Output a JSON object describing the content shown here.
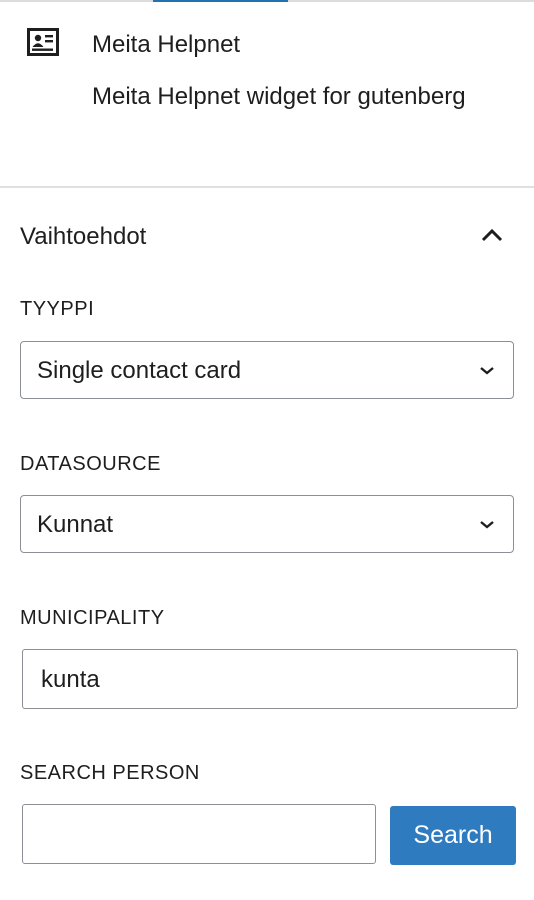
{
  "block": {
    "icon": "contact-card-icon",
    "title": "Meita Helpnet",
    "description": "Meita Helpnet widget for gutenberg"
  },
  "panel": {
    "title": "Vaihtoehdot",
    "toggle_icon": "chevron-up-icon",
    "expanded": true
  },
  "fields": {
    "type": {
      "label": "TYYPPI",
      "selected": "Single contact card"
    },
    "datasource": {
      "label": "DATASOURCE",
      "selected": "Kunnat"
    },
    "municipality": {
      "label": "MUNICIPALITY",
      "value": "kunta"
    },
    "search_person": {
      "label": "SEARCH PERSON",
      "value": "",
      "button_label": "Search"
    }
  },
  "colors": {
    "accent": "#2271b1",
    "button": "#2e7bbf",
    "border": "#8c8f94",
    "text": "#1e1e1e"
  }
}
